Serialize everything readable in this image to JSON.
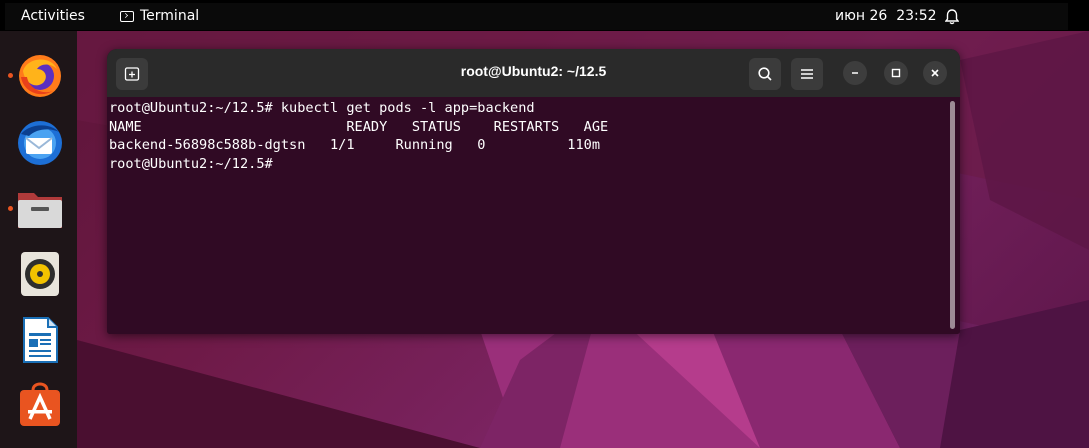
{
  "topbar": {
    "activities": "Activities",
    "app_name": "Terminal",
    "clock": "июн 26  23:52",
    "icons": [
      "terminal-icon",
      "bell-icon"
    ]
  },
  "dock": {
    "items": [
      {
        "name": "firefox",
        "running": true
      },
      {
        "name": "thunderbird",
        "running": false
      },
      {
        "name": "files",
        "running": true
      },
      {
        "name": "rhythmbox",
        "running": false
      },
      {
        "name": "libreoffice-writer",
        "running": false
      },
      {
        "name": "app-center",
        "running": false
      }
    ]
  },
  "window": {
    "title": "root@Ubuntu2: ~/12.5",
    "icons": [
      "new-tab-icon",
      "search-icon",
      "hamburger-menu-icon",
      "minimize-icon",
      "maximize-icon",
      "close-icon"
    ]
  },
  "terminal": {
    "lines": [
      "root@Ubuntu2:~/12.5# kubectl get pods -l app=backend",
      "NAME                         READY   STATUS    RESTARTS   AGE",
      "backend-56898c588b-dgtsn   1/1     Running   0          110m",
      "root@Ubuntu2:~/12.5#"
    ]
  },
  "colors": {
    "terminal_bg": "#300a24",
    "titlebar_bg": "#2a2a2a",
    "accent": "#e95420"
  }
}
